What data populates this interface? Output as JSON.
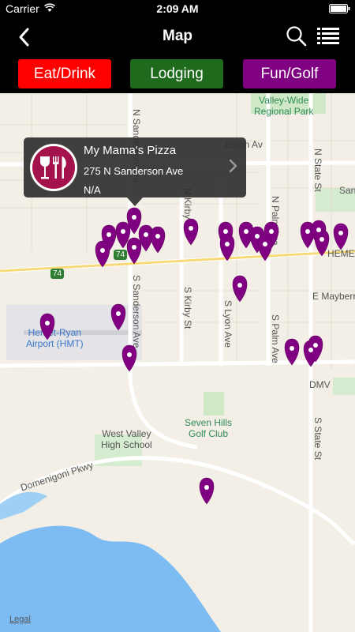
{
  "status_bar": {
    "carrier": "Carrier",
    "time": "2:09 AM"
  },
  "nav": {
    "title": "Map",
    "icons": [
      "chevron-left-icon",
      "search-icon",
      "list-icon"
    ]
  },
  "filters": [
    {
      "label": "Eat/Drink",
      "color": "#ff0000"
    },
    {
      "label": "Lodging",
      "color": "#1e6b1e"
    },
    {
      "label": "Fun/Golf",
      "color": "#7f0080"
    }
  ],
  "callout": {
    "name": "My Mama's Pizza",
    "address": "275 N Sanderson Ave",
    "extra": "N/A",
    "icon": "fork-knife-glass-icon"
  },
  "map": {
    "pin_color": "#7f0080",
    "labels": {
      "valley_wide": "Valley-Wide",
      "regional_park": "Regional Park",
      "eaton": "Eaton Av",
      "n_state": "N State St",
      "sanderson_n": "N Sanderson Ave",
      "sanderson_s": "S Sanderson Ave",
      "kirby_n": "N Kirby St",
      "kirby_s": "S Kirby St",
      "lyon": "S Lyon Ave",
      "palm_n": "N Palm Ave",
      "palm_s": "S Palm Ave",
      "hemet": "HEMET",
      "mayberry": "E Mayberry",
      "airport1": "Hemet-Ryan",
      "airport2": "Airport (HMT)",
      "dmv": "DMV",
      "seven_hills1": "Seven Hills",
      "seven_hills2": "Golf Club",
      "west_valley1": "West Valley",
      "west_valley2": "High School",
      "domenigoni": "Domenigoni Pkwy",
      "s_state": "S State St",
      "hwy": "74",
      "san": "San"
    },
    "legal": "Legal"
  }
}
